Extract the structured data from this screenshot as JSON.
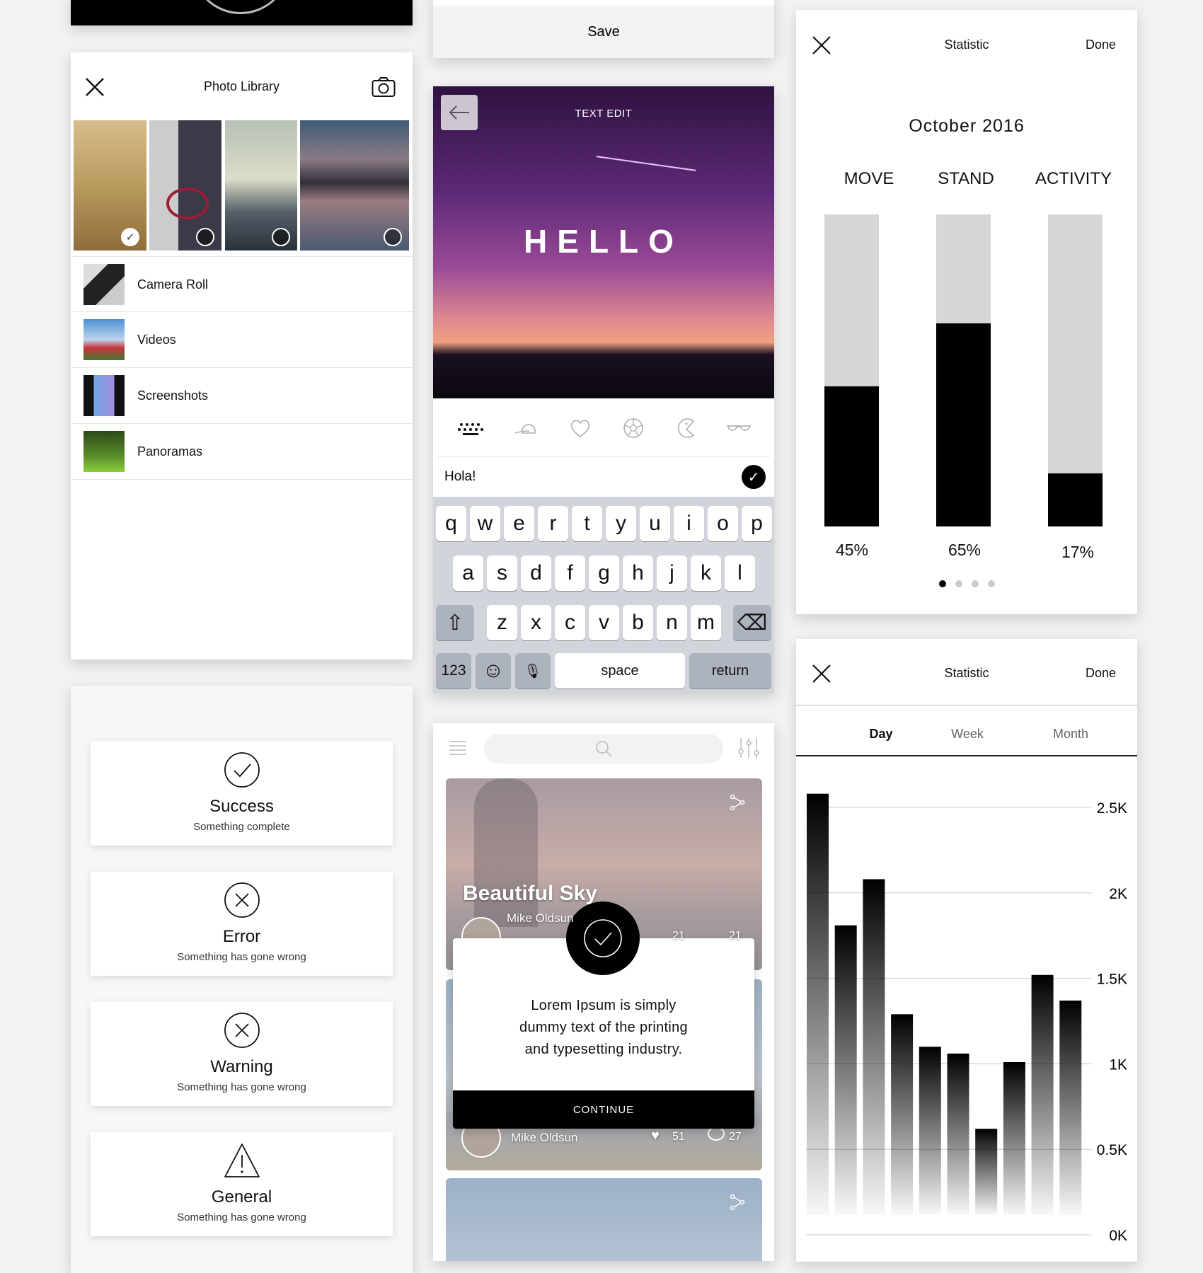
{
  "photo_library": {
    "title": "Photo Library",
    "albums": [
      {
        "label": "Camera Roll"
      },
      {
        "label": "Videos"
      },
      {
        "label": "Screenshots"
      },
      {
        "label": "Panoramas"
      }
    ],
    "selected_photo": 1
  },
  "alerts": [
    {
      "title": "Success",
      "subtitle": "Something complete",
      "icon": "check-circle-icon"
    },
    {
      "title": "Error",
      "subtitle": "Something has gone wrong",
      "icon": "x-circle-icon"
    },
    {
      "title": "Warning",
      "subtitle": "Something has gone wrong",
      "icon": "x-circle-icon"
    },
    {
      "title": "General",
      "subtitle": "Something has gone wrong",
      "icon": "warning-triangle-icon"
    }
  ],
  "save_panel": {
    "save_label": "Save"
  },
  "text_edit": {
    "title": "TEXT EDIT",
    "overlay_text": "HELLO",
    "input_value": "Hola!",
    "tool_icons": [
      "keyboard-icon",
      "cap-icon",
      "heart-icon",
      "soccer-ball-icon",
      "pacman-icon",
      "glasses-icon"
    ],
    "keyboard": {
      "row1": [
        "q",
        "w",
        "e",
        "r",
        "t",
        "y",
        "u",
        "i",
        "o",
        "p"
      ],
      "row2": [
        "a",
        "s",
        "d",
        "f",
        "g",
        "h",
        "j",
        "k",
        "l"
      ],
      "row3": [
        "z",
        "x",
        "c",
        "v",
        "b",
        "n",
        "m"
      ],
      "numbers": "123",
      "space": "space",
      "return": "return"
    }
  },
  "feed": {
    "cards": [
      {
        "title": "Beautiful Sky",
        "author": "Mike Oldsun",
        "likes": "21",
        "comments": "21"
      },
      {
        "title": "",
        "author": "Mike Oldsun",
        "likes": "51",
        "comments": "27"
      }
    ],
    "modal": {
      "message_lines": [
        "Lorem Ipsum is simply",
        "dummy text of the printing",
        "and typesetting industry."
      ],
      "button": "CONTINUE"
    }
  },
  "statistic_rings": {
    "title": "Statistic",
    "done": "Done",
    "month": "October 2016",
    "metrics": [
      {
        "label": "MOVE",
        "value": 45,
        "display": "45%"
      },
      {
        "label": "STAND",
        "value": 65,
        "display": "65%"
      },
      {
        "label": "ACTIVITY",
        "value": 17,
        "display": "17%"
      }
    ],
    "page_count": 4,
    "active_page": 1
  },
  "statistic_chart": {
    "title": "Statistic",
    "done": "Done",
    "tabs": [
      {
        "label": "Day",
        "active": true
      },
      {
        "label": "Week",
        "active": false
      },
      {
        "label": "Month",
        "active": false
      }
    ]
  },
  "chart_data": {
    "type": "bar",
    "values": [
      2.58,
      1.81,
      2.08,
      1.29,
      1.1,
      1.06,
      0.62,
      1.01,
      1.52,
      1.37
    ],
    "ylim": [
      0,
      2.5
    ],
    "yticks": [
      "0K",
      "0.5K",
      "1K",
      "1.5K",
      "2K",
      "2.5K"
    ],
    "grid": true,
    "axis_side": "right"
  }
}
